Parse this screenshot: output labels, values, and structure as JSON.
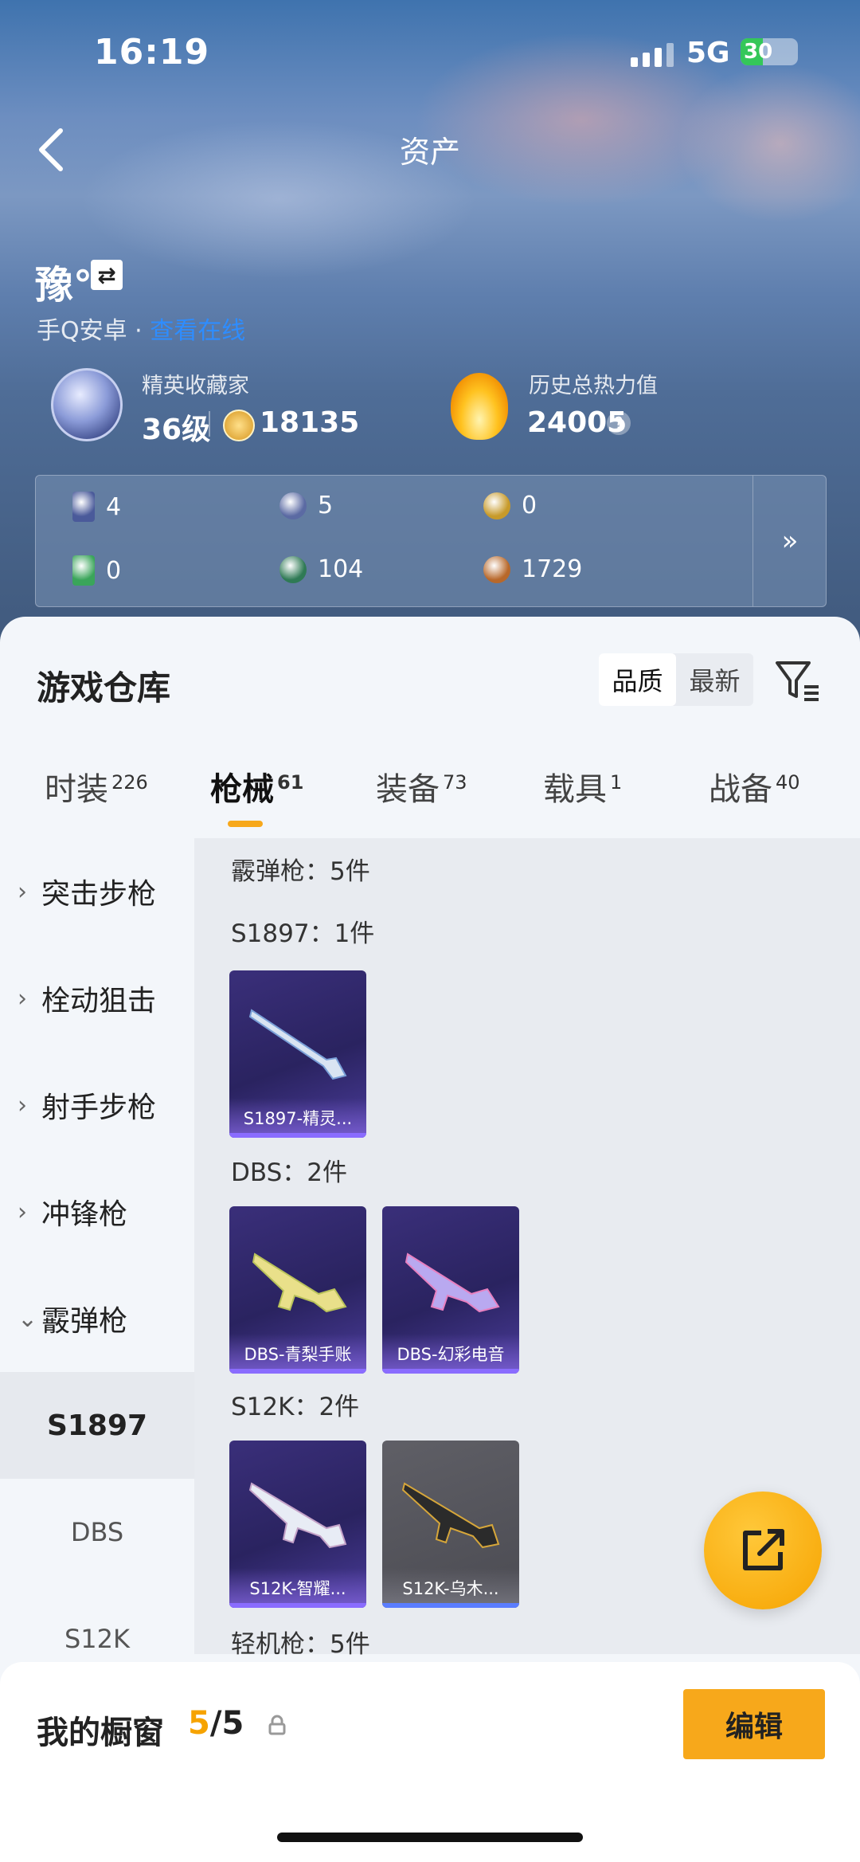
{
  "status_bar": {
    "time": "16:19",
    "network": "5G",
    "battery": "30"
  },
  "header": {
    "title": "资产"
  },
  "profile": {
    "name": "豫°",
    "platform": "手Q安卓 · ",
    "link": "查看在线",
    "collector_label": "精英收藏家",
    "collector_level": "36级",
    "collector_points": "18135",
    "heat_label": "历史总热力值",
    "heat_value": "24005",
    "heat_help": "?"
  },
  "currencies": [
    {
      "value": "4",
      "color": "#4a5a9a"
    },
    {
      "value": "5",
      "color": "#5b6aa3"
    },
    {
      "value": "0",
      "color": "#c79a2a"
    },
    {
      "value": "0",
      "color": "#3aa55a"
    },
    {
      "value": "104",
      "color": "#2f7a55"
    },
    {
      "value": "1729",
      "color": "#b8682a"
    }
  ],
  "currency_more": "»",
  "warehouse": {
    "title": "游戏仓库",
    "sort_quality": "品质",
    "sort_newest": "最新",
    "tabs": [
      {
        "label": "时装",
        "count": "226"
      },
      {
        "label": "枪械",
        "count": "61"
      },
      {
        "label": "装备",
        "count": "73"
      },
      {
        "label": "载具",
        "count": "1"
      },
      {
        "label": "战备",
        "count": "40"
      }
    ],
    "sidebar": [
      {
        "label": "突击步枪"
      },
      {
        "label": "栓动狙击"
      },
      {
        "label": "射手步枪"
      },
      {
        "label": "冲锋枪"
      },
      {
        "label": "霰弹枪"
      },
      {
        "label": "S1897"
      },
      {
        "label": "DBS"
      },
      {
        "label": "S12K"
      }
    ],
    "groups": {
      "category": "霰弹枪：5件",
      "s1897": "S1897：1件",
      "dbs": "DBS：2件",
      "s12k": "S12K：2件",
      "lmg": "轻机枪：5件"
    },
    "items": [
      {
        "name": "S1897-精灵...",
        "gun_color": "#d9e4f2",
        "accent": "#7aa0d8"
      },
      {
        "name": "DBS-青梨手账",
        "gun_color": "#e9e08a",
        "accent": "#b9c25a"
      },
      {
        "name": "DBS-幻彩电音",
        "gun_color": "#b9a9f0",
        "accent": "#e880c0"
      },
      {
        "name": "S12K-智耀...",
        "gun_color": "#e8ecf5",
        "accent": "#c4a2c8"
      },
      {
        "name": "S12K-乌木...",
        "gun_color": "#2b2b2b",
        "accent": "#d6a63a"
      }
    ]
  },
  "showcase": {
    "title": "我的橱窗",
    "current": "5",
    "total": "/5",
    "edit": "编辑"
  }
}
